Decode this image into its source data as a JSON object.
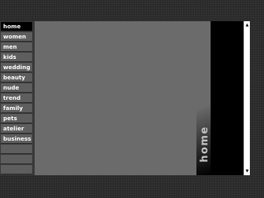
{
  "nav": {
    "items": [
      {
        "label": "home"
      },
      {
        "label": "women"
      },
      {
        "label": "men"
      },
      {
        "label": "kids"
      },
      {
        "label": "wedding"
      },
      {
        "label": "beauty"
      },
      {
        "label": "nude"
      },
      {
        "label": "trend"
      },
      {
        "label": "family"
      },
      {
        "label": "pets"
      },
      {
        "label": "atelier"
      },
      {
        "label": "business"
      }
    ],
    "active": "home"
  },
  "section_label": "home",
  "scrollbar": {
    "up_icon": "arrow-up-icon",
    "down_icon": "arrow-down-icon"
  }
}
